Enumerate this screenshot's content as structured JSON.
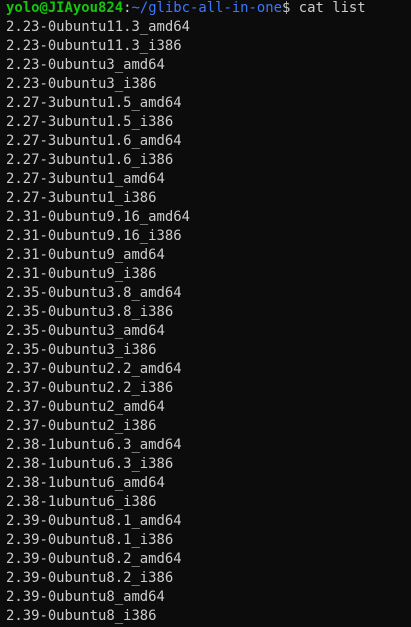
{
  "prompt": {
    "user_host": "yolo@JIAyou824",
    "colon": ":",
    "path": "~/glibc-all-in-one",
    "dollar": "$ ",
    "command": "cat list"
  },
  "output": [
    "2.23-0ubuntu11.3_amd64",
    "2.23-0ubuntu11.3_i386",
    "2.23-0ubuntu3_amd64",
    "2.23-0ubuntu3_i386",
    "2.27-3ubuntu1.5_amd64",
    "2.27-3ubuntu1.5_i386",
    "2.27-3ubuntu1.6_amd64",
    "2.27-3ubuntu1.6_i386",
    "2.27-3ubuntu1_amd64",
    "2.27-3ubuntu1_i386",
    "2.31-0ubuntu9.16_amd64",
    "2.31-0ubuntu9.16_i386",
    "2.31-0ubuntu9_amd64",
    "2.31-0ubuntu9_i386",
    "2.35-0ubuntu3.8_amd64",
    "2.35-0ubuntu3.8_i386",
    "2.35-0ubuntu3_amd64",
    "2.35-0ubuntu3_i386",
    "2.37-0ubuntu2.2_amd64",
    "2.37-0ubuntu2.2_i386",
    "2.37-0ubuntu2_amd64",
    "2.37-0ubuntu2_i386",
    "2.38-1ubuntu6.3_amd64",
    "2.38-1ubuntu6.3_i386",
    "2.38-1ubuntu6_amd64",
    "2.38-1ubuntu6_i386",
    "2.39-0ubuntu8.1_amd64",
    "2.39-0ubuntu8.1_i386",
    "2.39-0ubuntu8.2_amd64",
    "2.39-0ubuntu8.2_i386",
    "2.39-0ubuntu8_amd64",
    "2.39-0ubuntu8_i386"
  ],
  "colors": {
    "background": "#0c0c0c",
    "text": "#cccccc",
    "prompt_user": "#16c60c",
    "prompt_path": "#3b78ff"
  }
}
